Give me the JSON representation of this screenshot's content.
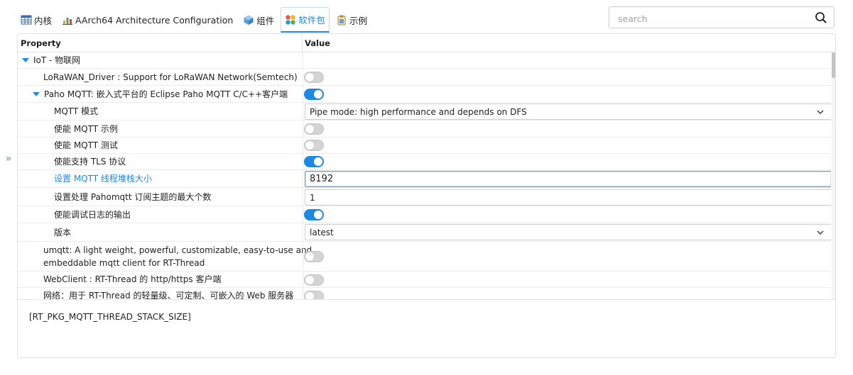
{
  "tabs": [
    {
      "label": "内核",
      "icon": "table-icon"
    },
    {
      "label": "AArch64 Architecture Configuration",
      "icon": "chart-icon"
    },
    {
      "label": "组件",
      "icon": "cube-icon"
    },
    {
      "label": "软件包",
      "icon": "packages-icon",
      "active": true
    },
    {
      "label": "示例",
      "icon": "clipboard-icon"
    }
  ],
  "search": {
    "placeholder": "search",
    "value": ""
  },
  "table": {
    "col_property": "Property",
    "col_value": "Value"
  },
  "rows": {
    "iot": {
      "label": "IoT - 物联网"
    },
    "lorawan": {
      "label": "LoRaWAN_Driver : Support for LoRaWAN Network(Semtech)",
      "enabled": false
    },
    "paho": {
      "label": "Paho MQTT: 嵌入式平台的 Eclipse Paho MQTT C/C++客户端",
      "enabled": true
    },
    "mqtt_mode": {
      "label": "MQTT 模式",
      "value": "Pipe mode: high performance and depends on DFS"
    },
    "mqtt_example": {
      "label": "使能 MQTT 示例",
      "enabled": false
    },
    "mqtt_test": {
      "label": "使能 MQTT 测试",
      "enabled": false
    },
    "tls": {
      "label": "使能支持 TLS 协议",
      "enabled": true
    },
    "stack_size": {
      "label": "设置 MQTT 线程堆栈大小",
      "value": "8192"
    },
    "max_topics": {
      "label": "设置处理 Pahomqtt 订阅主题的最大个数",
      "value": "1"
    },
    "debug_log": {
      "label": "使能调试日志的输出",
      "enabled": true
    },
    "version": {
      "label": "版本",
      "value": "latest"
    },
    "umqtt": {
      "label_line1": "umqtt: A light weight, powerful, customizable, easy-to-use and",
      "label_line2": "embeddable mqtt client for RT-Thread",
      "enabled": false
    },
    "webclient": {
      "label": "WebClient : RT-Thread 的 http/https 客户端",
      "enabled": false
    },
    "webnet": {
      "label": "网络：用于 RT-Thread 的轻量级、可定制、可嵌入的 Web 服务器",
      "enabled": false
    }
  },
  "description": "[RT_PKG_MQTT_THREAD_STACK_SIZE]",
  "colors": {
    "accent": "#1e88e5",
    "toggle_off": "#d4d4d4"
  }
}
